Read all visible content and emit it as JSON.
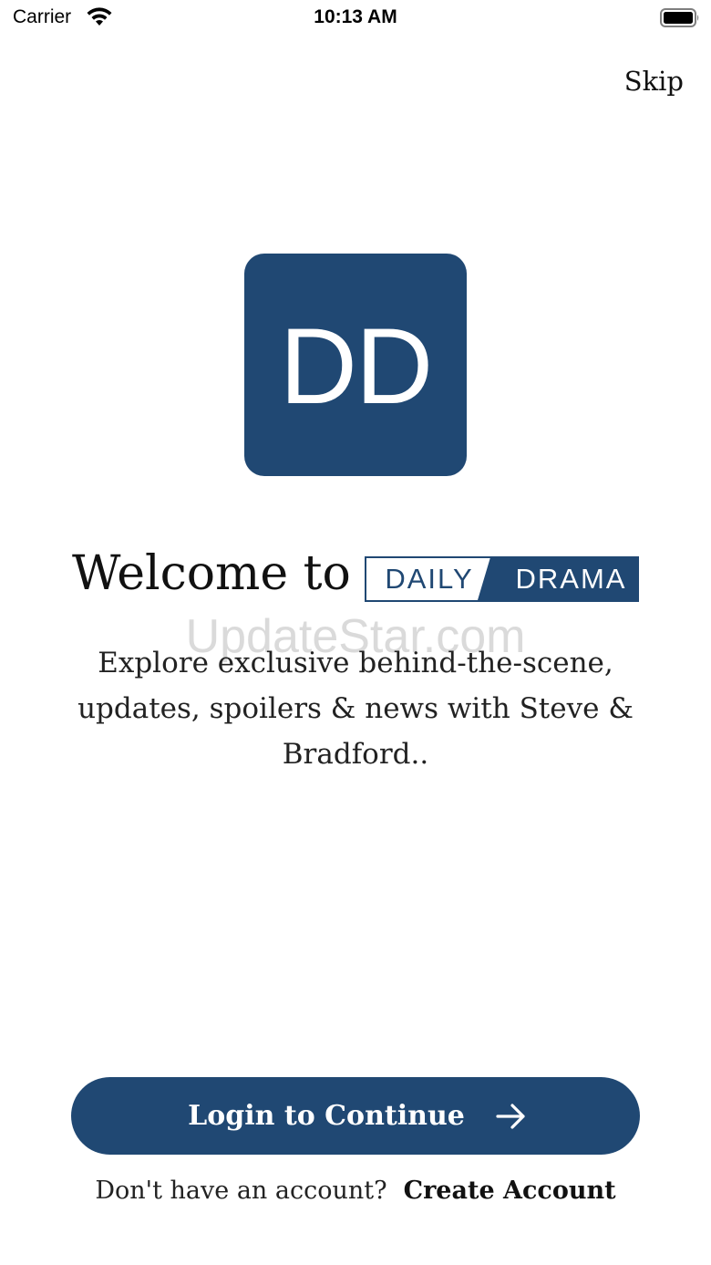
{
  "status_bar": {
    "carrier": "Carrier",
    "time": "10:13 AM"
  },
  "skip_label": "Skip",
  "logo": {
    "text": "DD",
    "color": "#204873"
  },
  "welcome": {
    "prefix": "Welcome to",
    "brand_left": "DAILY",
    "brand_right": "DRAMA"
  },
  "watermark": "UpdateStar.com",
  "description": "Explore exclusive behind-the-scene, updates, spoilers & news with Steve & Bradford..",
  "login_button": {
    "label": "Login to Continue",
    "icon": "arrow-right-icon"
  },
  "footer": {
    "prompt": "Don't have an account?",
    "link": "Create Account"
  },
  "colors": {
    "primary": "#204873",
    "background": "#ffffff"
  }
}
